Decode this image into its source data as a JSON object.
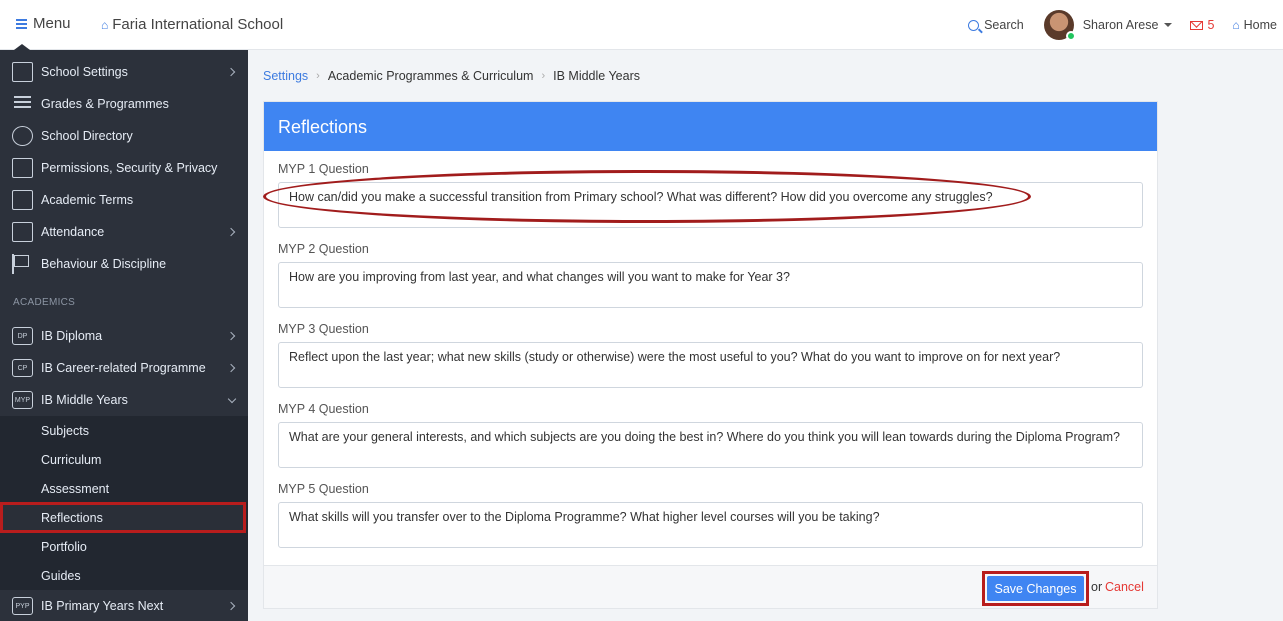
{
  "topbar": {
    "menu_label": "Menu",
    "school_name": "Faria International School",
    "search_label": "Search",
    "user_name": "Sharon Arese",
    "mail_count": "5",
    "home_label": "Home"
  },
  "sidebar": {
    "items": [
      {
        "label": "School Settings",
        "icon": "bank-icon"
      },
      {
        "label": "Grades & Programmes",
        "icon": "list-icon"
      },
      {
        "label": "School Directory",
        "icon": "users-icon"
      },
      {
        "label": "Permissions, Security & Privacy",
        "icon": "lock-icon"
      },
      {
        "label": "Academic Terms",
        "icon": "calendar-icon"
      },
      {
        "label": "Attendance",
        "icon": "calendar-clock-icon"
      },
      {
        "label": "Behaviour & Discipline",
        "icon": "flag-icon"
      }
    ],
    "section_label": "ACADEMICS",
    "programmes": [
      {
        "label": "IB Diploma",
        "tag": "DP"
      },
      {
        "label": "IB Career-related Programme",
        "tag": "CP"
      },
      {
        "label": "IB Middle Years",
        "tag": "MYP"
      }
    ],
    "sub_items": [
      "Subjects",
      "Curriculum",
      "Assessment",
      "Reflections",
      "Portfolio",
      "Guides"
    ],
    "last_programme": {
      "label": "IB Primary Years Next",
      "tag": "PYP"
    }
  },
  "breadcrumb": {
    "settings": "Settings",
    "programmes": "Academic Programmes & Curriculum",
    "current": "IB Middle Years"
  },
  "panel": {
    "title": "Reflections",
    "questions": [
      {
        "label": "MYP 1 Question",
        "value": "How can/did you make a successful transition from Primary school? What was different? How did you overcome any struggles?"
      },
      {
        "label": "MYP 2 Question",
        "value": "How are you improving from last year, and what changes will you want to make for Year 3?"
      },
      {
        "label": "MYP 3 Question",
        "value": "Reflect upon the last year; what new skills (study or otherwise) were the most useful to you? What do you want to improve on for next year?"
      },
      {
        "label": "MYP 4 Question",
        "value": "What are your general interests, and which subjects are you doing the best in? Where do you think you will lean towards during the Diploma Program?"
      },
      {
        "label": "MYP 5 Question",
        "value": "What skills will you transfer over to the Diploma Programme? What higher level courses will you be taking?"
      }
    ],
    "save_label": "Save Changes",
    "or_label": "or",
    "cancel_label": "Cancel"
  }
}
